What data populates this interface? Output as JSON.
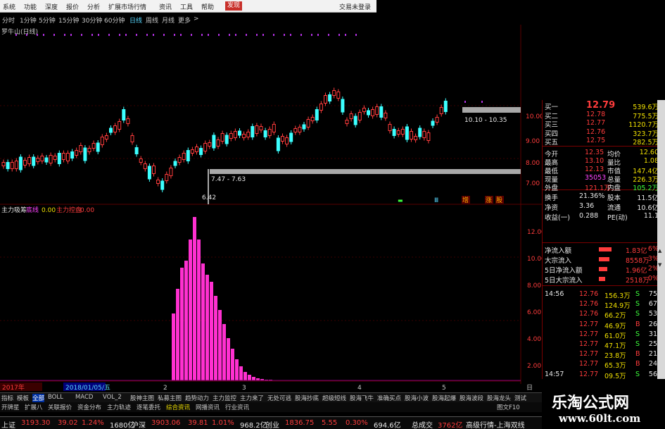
{
  "menu": {
    "items": [
      "系统",
      "功能",
      "深度",
      "报价",
      "分析",
      "扩展市场行情",
      "资讯",
      "工具",
      "帮助",
      "发现"
    ],
    "active": "发现",
    "login": "交易未登录"
  },
  "periods": [
    "分时",
    "1分钟",
    "5分钟",
    "15分钟",
    "30分钟",
    "60分钟",
    "日线",
    "周线",
    "月线",
    "更多",
    ">"
  ],
  "selected_period": "日线",
  "chart_title": "罗牛山(日线)",
  "price_axis": [
    "10.00",
    "9.00",
    "8.00",
    "7.00"
  ],
  "range_labels": {
    "upper": "10.10 - 10.35",
    "lower": "7.47 - 7.63",
    "low": "6.42"
  },
  "indicator_legend": {
    "a": "主力吸筹",
    "b": "底线",
    "c": "0.00",
    "d": "主力控盘",
    "e": "0.00"
  },
  "indicator_axis": [
    "12.00",
    "10.00",
    "8.00",
    "6.00",
    "4.00",
    "2.00"
  ],
  "event_marks": [
    "增",
    "涨",
    "股"
  ],
  "date_axis": {
    "year": "2017年",
    "date": "2018/01/05/五",
    "ticks": [
      "2",
      "3",
      "4",
      "5"
    ],
    "right": "日"
  },
  "quote": {
    "asks": [
      {
        "label": "买一",
        "price": "12.79",
        "vol": "539.6万"
      },
      {
        "label": "买二",
        "price": "12.78",
        "vol": "775.5万"
      },
      {
        "label": "买三",
        "price": "12.77",
        "vol": "1120.7万"
      },
      {
        "label": "买四",
        "price": "12.76",
        "vol": "323.7万"
      },
      {
        "label": "买五",
        "price": "12.75",
        "vol": "282.5万"
      }
    ],
    "stats": [
      {
        "l1": "今开",
        "v1": "12.35",
        "l2": "均价",
        "v2": "12.60"
      },
      {
        "l1": "最高",
        "v1": "13.10",
        "l2": "量比",
        "v2": "1.08"
      },
      {
        "l1": "最低",
        "v1": "12.13",
        "l2": "市值",
        "v2": "147.4亿"
      },
      {
        "l1": "现量",
        "v1": "35053",
        "l2": "总量",
        "v2": "226.3万"
      },
      {
        "l1": "外盘",
        "v1": "121.1万",
        "l2": "内盘",
        "v2": "105.2万"
      }
    ],
    "stats2": [
      {
        "l1": "换手",
        "v1": "21.36%",
        "l2": "股本",
        "v2": "11.5亿"
      },
      {
        "l1": "净资",
        "v1": "3.36",
        "l2": "流通",
        "v2": "10.6亿"
      },
      {
        "l1": "收益(一)",
        "v1": "0.288",
        "l2": "PE(动)",
        "v2": "11.1"
      }
    ],
    "flows": [
      {
        "label": "净流入额",
        "value": "1.83亿",
        "pct": "6%"
      },
      {
        "label": "大宗流入",
        "value": "8558万",
        "pct": "3%"
      },
      {
        "label": "5日净流入额",
        "value": "1.96亿",
        "pct": "2%"
      },
      {
        "label": "5日大宗流入",
        "value": "2518万",
        "pct": "0%"
      }
    ],
    "ticks": [
      {
        "time": "14:56",
        "price": "12.76",
        "vol": "156.3万",
        "bs": "S",
        "n": "75"
      },
      {
        "time": "",
        "price": "12.76",
        "vol": "124.9万",
        "bs": "S",
        "n": "67"
      },
      {
        "time": "",
        "price": "12.76",
        "vol": "66.2万",
        "bs": "S",
        "n": "53"
      },
      {
        "time": "",
        "price": "12.77",
        "vol": "46.9万",
        "bs": "B",
        "n": "26"
      },
      {
        "time": "",
        "price": "12.77",
        "vol": "61.0万",
        "bs": "S",
        "n": "31"
      },
      {
        "time": "",
        "price": "12.77",
        "vol": "47.1万",
        "bs": "S",
        "n": "25"
      },
      {
        "time": "",
        "price": "12.77",
        "vol": "23.8万",
        "bs": "B",
        "n": "21"
      },
      {
        "time": "",
        "price": "12.77",
        "vol": "65.3万",
        "bs": "B",
        "n": "24"
      },
      {
        "time": "14:57",
        "price": "12.77",
        "vol": "09.5万",
        "bs": "S",
        "n": "56"
      }
    ]
  },
  "tabs_row1": [
    "指标",
    "模板",
    "全部",
    "BOLL",
    "MACD",
    "VOL_2",
    "股神主图",
    "私募主图",
    "趋势动力",
    "主力监控",
    "主力来了",
    "无处可逃",
    "股海抄底",
    "超级短线",
    "股海飞牛",
    "准确买点",
    "股海小波",
    "股海起爆",
    "股海波段",
    "股海龙头",
    "测试"
  ],
  "tabs_row2": [
    "开牌星",
    "扩展八",
    "关联报价",
    "资金分布",
    "主力轨迹",
    "逐笔委托",
    "综合资讯",
    "网播资讯",
    "行业资讯"
  ],
  "tabs_row2_right": "图文F10",
  "status": [
    {
      "name": "上证",
      "price": "3193.30",
      "chg": "39.02",
      "pct": "1.24%",
      "amt": "1680亿"
    },
    {
      "name": "沪深",
      "price": "3903.06",
      "chg": "39.81",
      "pct": "1.01%",
      "amt": "968.2亿"
    },
    {
      "name": "创业",
      "price": "1836.75",
      "chg": "5.55",
      "pct": "0.30%",
      "amt": "694.6亿"
    }
  ],
  "status_extra": {
    "label": "总成交",
    "value": "3762亿",
    "info": "高级行情-上海双线"
  },
  "brand": {
    "title": "乐淘公式网",
    "url": "www.60lt.com"
  },
  "colors": {
    "up": "#ff3c3c",
    "down": "#3cffff",
    "bar": "#ff30d0",
    "accent": "#f0e000"
  }
}
